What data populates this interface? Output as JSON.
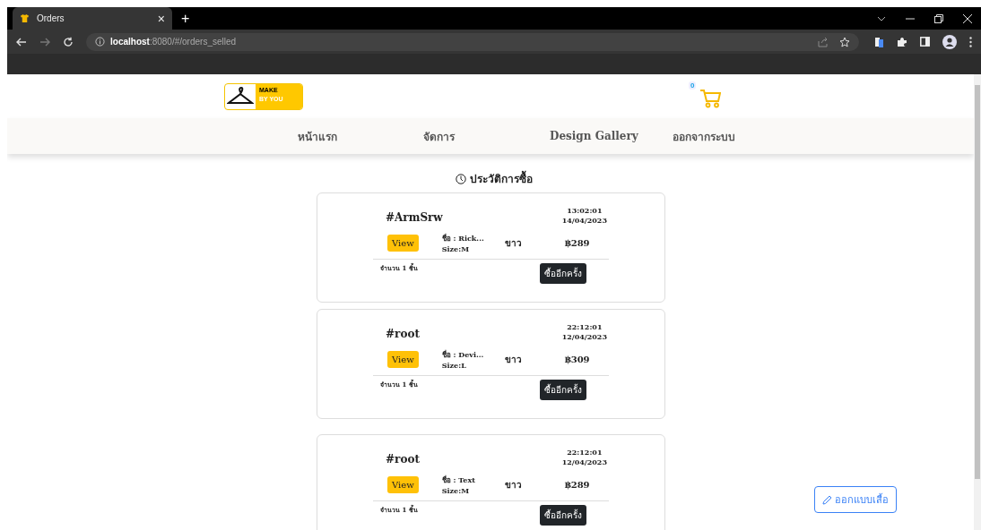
{
  "browser": {
    "tab": {
      "title": "Orders",
      "close": "×"
    },
    "new_tab": "+",
    "address": {
      "host": "localhost",
      "rest": ":8080/#/orders_selled"
    }
  },
  "header": {
    "logo": {
      "line1": "MAKE",
      "line2": "BY YOU"
    },
    "cart_count": "0"
  },
  "nav": [
    {
      "label": "หน้าแรก"
    },
    {
      "label": "จัดการ"
    },
    {
      "label": "Design Gallery"
    },
    {
      "label": "ออกจากระบบ"
    }
  ],
  "page_title": "ประวัติการซื้อ",
  "orders": [
    {
      "code": "#ArmSrw",
      "time": "13:02:01",
      "date": "14/04/2023",
      "view": "View",
      "name": "ชื่อ : Rick...",
      "size": "Size:M",
      "colour_name": "ขาว",
      "price": "฿289",
      "quantity": "จำนวน 1 ชิ้น",
      "rebuy": "ซื้ออีกครั้ง"
    },
    {
      "code": "#root",
      "time": "22:12:01",
      "date": "12/04/2023",
      "view": "View",
      "name": "ชื่อ : Devi...",
      "size": "Size:L",
      "colour_name": "ขาว",
      "price": "฿309",
      "quantity": "จำนวน 1 ชิ้น",
      "rebuy": "ซื้ออีกครั้ง"
    },
    {
      "code": "#root",
      "time": "22:12:01",
      "date": "12/04/2023",
      "view": "View",
      "name": "ชื่อ : Text",
      "size": "Size:M",
      "colour_name": "ขาว",
      "price": "฿289",
      "quantity": "จำนวน 1 ชิ้น",
      "rebuy": "ซื้ออีกครั้ง"
    }
  ],
  "design_button": "ออกแบบเสื้อ"
}
